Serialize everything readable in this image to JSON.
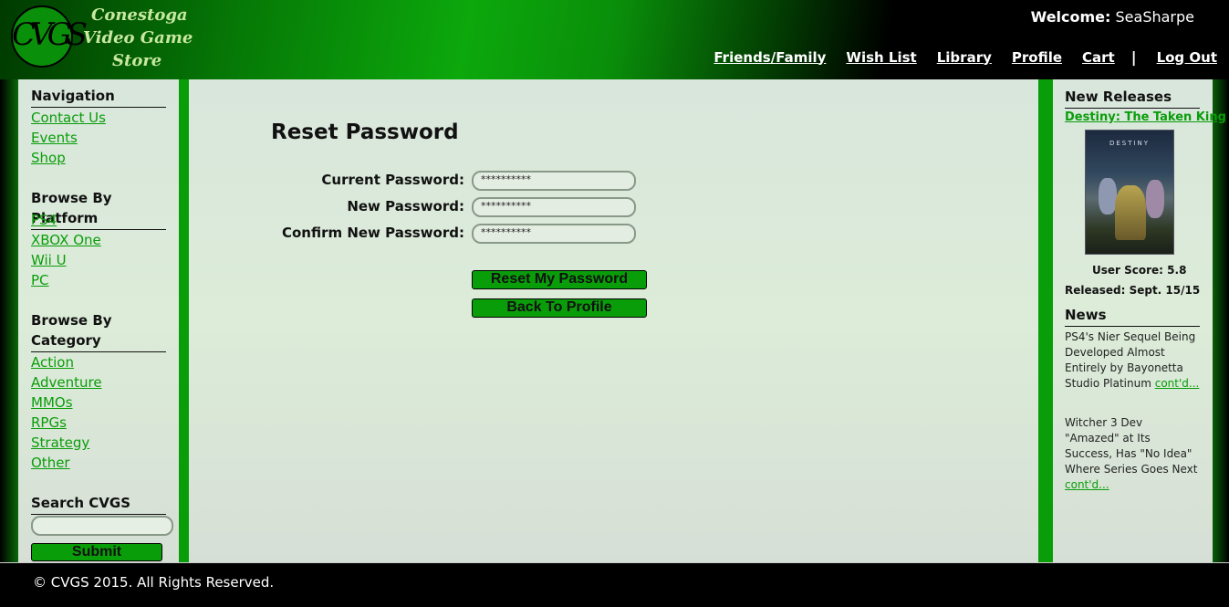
{
  "header": {
    "logo_letters": "CVGS",
    "logo_lines": [
      "Conestoga",
      "Video  Game",
      "Store"
    ],
    "welcome_label": "Welcome:",
    "welcome_user": "SeaSharpe",
    "nav": [
      "Friends/Family",
      "Wish List",
      "Library",
      "Profile",
      "Cart"
    ],
    "separator": "|",
    "logout": "Log Out"
  },
  "left": {
    "navigation_title": "Navigation",
    "navigation_links": [
      "Contact Us",
      "Events",
      "Shop"
    ],
    "platform_title": "Browse By Platform",
    "platform_links": [
      "PS4",
      "XBOX One",
      "Wii U",
      "PC"
    ],
    "category_title_1": "Browse By",
    "category_title_2": "Category",
    "category_links": [
      "Action",
      "Adventure",
      "MMOs",
      "RPGs",
      "Strategy",
      "Other"
    ],
    "search_title": "Search CVGS",
    "search_value": "",
    "search_button": "Submit"
  },
  "main": {
    "title": "Reset Password",
    "fields": [
      {
        "label": "Current Password:",
        "value": "**********"
      },
      {
        "label": "New Password:",
        "value": "**********"
      },
      {
        "label": "Confirm New Password:",
        "value": "**********"
      }
    ],
    "reset_button": "Reset My Password",
    "back_button": "Back To Profile"
  },
  "right": {
    "new_releases_title": "New Releases",
    "game_title": "Destiny: The Taken King",
    "cover_text": "DESTINY",
    "user_score": "User Score: 5.8",
    "released": "Released: Sept. 15/15",
    "news_title": "News",
    "news": [
      {
        "text": "PS4's Nier Sequel Being Developed Almost Entirely by Bayonetta Studio Platinum ",
        "more": "cont'd..."
      },
      {
        "text": "Witcher 3 Dev \"Amazed\" at Its Success, Has \"No Idea\" Where Series Goes Next ",
        "more": "cont'd..."
      }
    ]
  },
  "footer": {
    "copyright": "© CVGS 2015. All Rights Reserved."
  },
  "colors": {
    "accent": "#0a9d0a",
    "panel": "#dce8dc",
    "header": "#000000"
  }
}
